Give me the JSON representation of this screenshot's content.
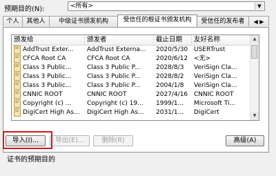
{
  "purpose": {
    "label": "预期目的(N):",
    "selected": "<所有>"
  },
  "tabs": [
    {
      "label": "个人"
    },
    {
      "label": "其他人"
    },
    {
      "label": "中级证书颁发机构"
    },
    {
      "label": "受信任的根证书颁发机构"
    },
    {
      "label": "受信任的发布者"
    }
  ],
  "table": {
    "columns": [
      "颁发给",
      "颁发者",
      "截止日期",
      "友好名称"
    ],
    "rows": [
      {
        "issued_to": "AddTrust Exter...",
        "issuer": "AddTrust Externa...",
        "expires": "2020/5/30",
        "friendly": "USERTrust"
      },
      {
        "issued_to": "CFCA Root CA",
        "issuer": "CFCA Root CA",
        "expires": "2020/6/12",
        "friendly": "<无>"
      },
      {
        "issued_to": "Class 3 Public...",
        "issuer": "Class 3 Public P...",
        "expires": "2028/8/3",
        "friendly": "VeriSign Cla..."
      },
      {
        "issued_to": "Class 3 Public...",
        "issuer": "Class 3 Public P...",
        "expires": "2028/8/2",
        "friendly": "VeriSign Cla..."
      },
      {
        "issued_to": "Class 3 Public...",
        "issuer": "Class 3 Public P...",
        "expires": "2004/1/8",
        "friendly": "VeriSign Cla..."
      },
      {
        "issued_to": "CNNIC ROOT",
        "issuer": "CNNIC ROOT",
        "expires": "2027/4/16",
        "friendly": "CNNIC ROOT"
      },
      {
        "issued_to": "Copyright (c) ...",
        "issuer": "Copyright (c) 19...",
        "expires": "1999/1...",
        "friendly": "Microsoft Ti..."
      },
      {
        "issued_to": "DigiCert High As...",
        "issuer": "DigiCert High As...",
        "expires": "2031/1...",
        "friendly": "DigiCert"
      }
    ]
  },
  "buttons": {
    "import": "导入(I)...",
    "export": "导出(E)...",
    "remove": "删除(R)",
    "advanced": "高级(A)"
  },
  "footer": {
    "label": "证书的预期目的"
  },
  "colors": {
    "highlight": "#d0151c"
  },
  "icons": {
    "row_icon": "certificate-icon",
    "dropdown": "chevron-down-icon"
  }
}
